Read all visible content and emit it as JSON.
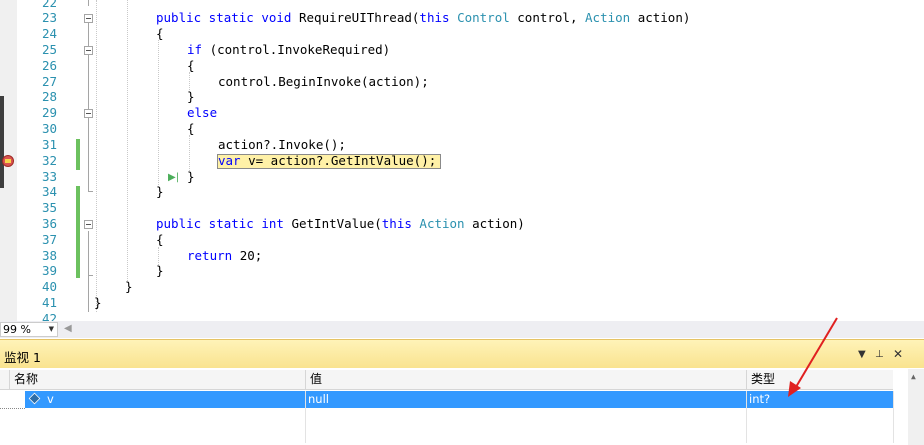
{
  "editor": {
    "lines": [
      {
        "num": "22",
        "text": ""
      },
      {
        "num": "23",
        "text": "public static void RequireUIThread(this Control control, Action action)"
      },
      {
        "num": "24",
        "text": "{"
      },
      {
        "num": "25",
        "text": "if (control.InvokeRequired)"
      },
      {
        "num": "26",
        "text": "{"
      },
      {
        "num": "27",
        "text": "control.BeginInvoke(action);"
      },
      {
        "num": "28",
        "text": "}"
      },
      {
        "num": "29",
        "text": "else"
      },
      {
        "num": "30",
        "text": "{"
      },
      {
        "num": "31",
        "text": "action?.Invoke();"
      },
      {
        "num": "32",
        "text": "var v= action?.GetIntValue();"
      },
      {
        "num": "33",
        "text": "}"
      },
      {
        "num": "34",
        "text": "}"
      },
      {
        "num": "35",
        "text": ""
      },
      {
        "num": "36",
        "text": "public static int GetIntValue(this Action action)"
      },
      {
        "num": "37",
        "text": "{"
      },
      {
        "num": "38",
        "text": "return 20;"
      },
      {
        "num": "39",
        "text": "}"
      },
      {
        "num": "40",
        "text": "}"
      },
      {
        "num": "41",
        "text": "}"
      },
      {
        "num": "42",
        "text": ""
      }
    ]
  },
  "status": {
    "zoom": "99 %"
  },
  "watch": {
    "title": "监视 1",
    "columns": {
      "name": "名称",
      "value": "值",
      "type": "类型"
    },
    "rows": [
      {
        "name": "v",
        "value": "null",
        "type": "int?"
      }
    ]
  },
  "colors": {
    "keyword": "#0000ff",
    "type": "#2b91af",
    "line_number": "#2b91af",
    "selection": "#3399ff",
    "annotation_arrow": "#e02020"
  },
  "icons": [
    "breakpoint-icon",
    "fold-toggle-icon",
    "step-icon",
    "object-icon",
    "dropdown-icon",
    "pin-icon",
    "close-icon"
  ]
}
